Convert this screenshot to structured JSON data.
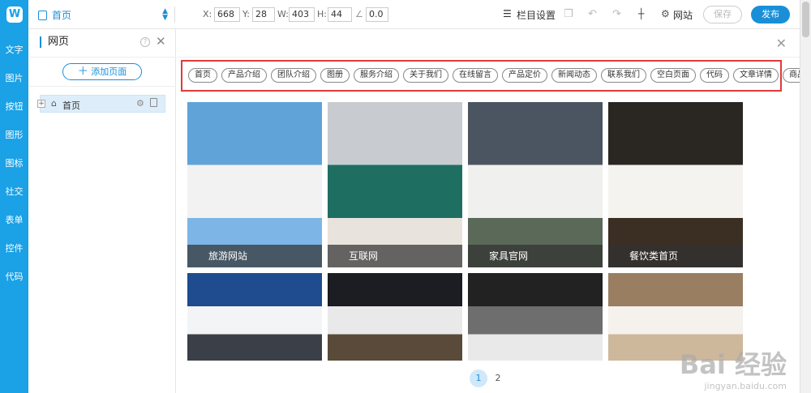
{
  "leftbar": {
    "logo": "W",
    "items": [
      "文字",
      "图片",
      "按钮",
      "图形",
      "图标",
      "社交",
      "表单",
      "控件",
      "代码"
    ]
  },
  "topbar": {
    "page_select": "首页",
    "x_label": "X:",
    "x_value": "668",
    "y_label": "Y:",
    "y_value": "28",
    "w_label": "W:",
    "w_value": "403",
    "h_label": "H:",
    "h_value": "44",
    "angle_value": "0.0",
    "column_settings": "栏目设置",
    "website": "网站",
    "save": "保存",
    "publish": "发布"
  },
  "sidepanel": {
    "title": "网页",
    "help": "?",
    "add_page": "添加页面",
    "pages": [
      {
        "label": "首页"
      }
    ]
  },
  "main": {
    "tags": [
      "首页",
      "产品介绍",
      "团队介绍",
      "图册",
      "服务介绍",
      "关于我们",
      "在线留言",
      "产品定价",
      "新闻动态",
      "联系我们",
      "空白页面",
      "代码",
      "文章详情",
      "商品详情"
    ],
    "cards": [
      {
        "caption": "旅游网站",
        "top": "#5fa3d9",
        "mid": "#f2f2f2",
        "band": "#7db6e6"
      },
      {
        "caption": "互联网",
        "top": "#c8ccd1",
        "mid": "#1f6e62",
        "band": "#e8e3dc"
      },
      {
        "caption": "家具官网",
        "top": "#4b5561",
        "mid": "#f0f0ee",
        "band": "#5b6a58"
      },
      {
        "caption": "餐饮类首页",
        "top": "#2a2622",
        "mid": "#f5f3ef",
        "band": "#3b2e22"
      },
      {
        "caption": "",
        "top": "#1f4b8f",
        "mid": "#f2f4f6",
        "band": "#3b3f47"
      },
      {
        "caption": "",
        "top": "#1b1d22",
        "mid": "#e9e9e9",
        "band": "#5a4a3a"
      },
      {
        "caption": "",
        "top": "#222222",
        "mid": "#6e6e6e",
        "band": "#e9e9e9"
      },
      {
        "caption": "",
        "top": "#9a7e62",
        "mid": "#f5f1ec",
        "band": "#cdb89c"
      }
    ],
    "pages": [
      "1",
      "2"
    ]
  },
  "watermark": {
    "main": "Bai 经验",
    "sub": "jingyan.baidu.com"
  }
}
